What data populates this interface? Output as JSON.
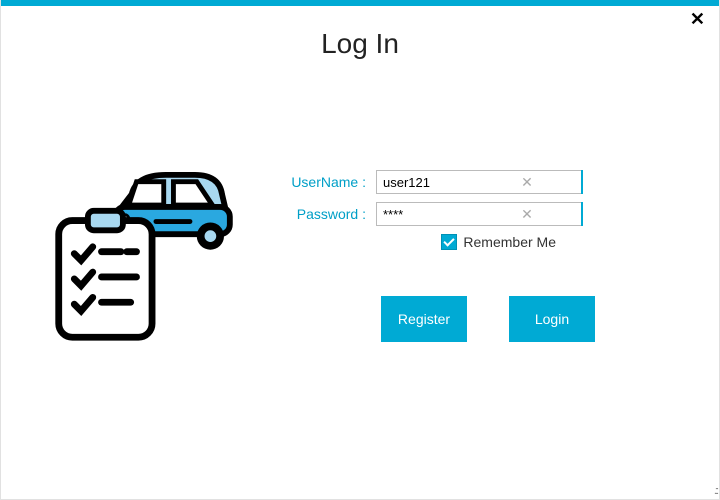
{
  "title": "Log In",
  "fields": {
    "username": {
      "label": "UserName :",
      "value": "user121"
    },
    "password": {
      "label": "Password :",
      "value": "****"
    }
  },
  "remember": {
    "label": "Remember Me",
    "checked": true
  },
  "buttons": {
    "register": "Register",
    "login": "Login"
  },
  "colors": {
    "accent": "#00aad4"
  }
}
